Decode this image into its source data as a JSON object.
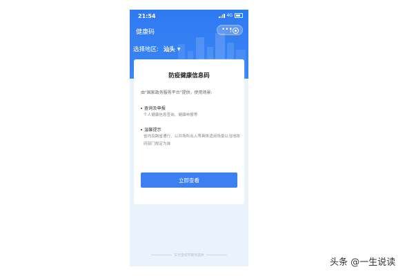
{
  "status_bar": {
    "time": "21:54",
    "network": "4G"
  },
  "app": {
    "title": "健康码"
  },
  "region": {
    "label": "选择地区:",
    "value": "汕头"
  },
  "card": {
    "title": "防疫健康信息码",
    "intro": "由\"国家政务服务平台\"提供，使用场景:",
    "sections": [
      {
        "title": "查询及申报",
        "text": "个人健康信息查询、健康申报等"
      },
      {
        "title": "温馨提示",
        "text": "省内及跨省通行、公共场所出入等具体适用场景以当地政府部门规定为准"
      }
    ],
    "button_label": "立即查看"
  },
  "footer": {
    "text": "支付宝城市服务提供"
  },
  "watermark": {
    "text": "头条 @一生说读"
  },
  "colors": {
    "primary": "#3d7ff0",
    "header": "#2f7af1",
    "background": "#eaf3fc"
  }
}
